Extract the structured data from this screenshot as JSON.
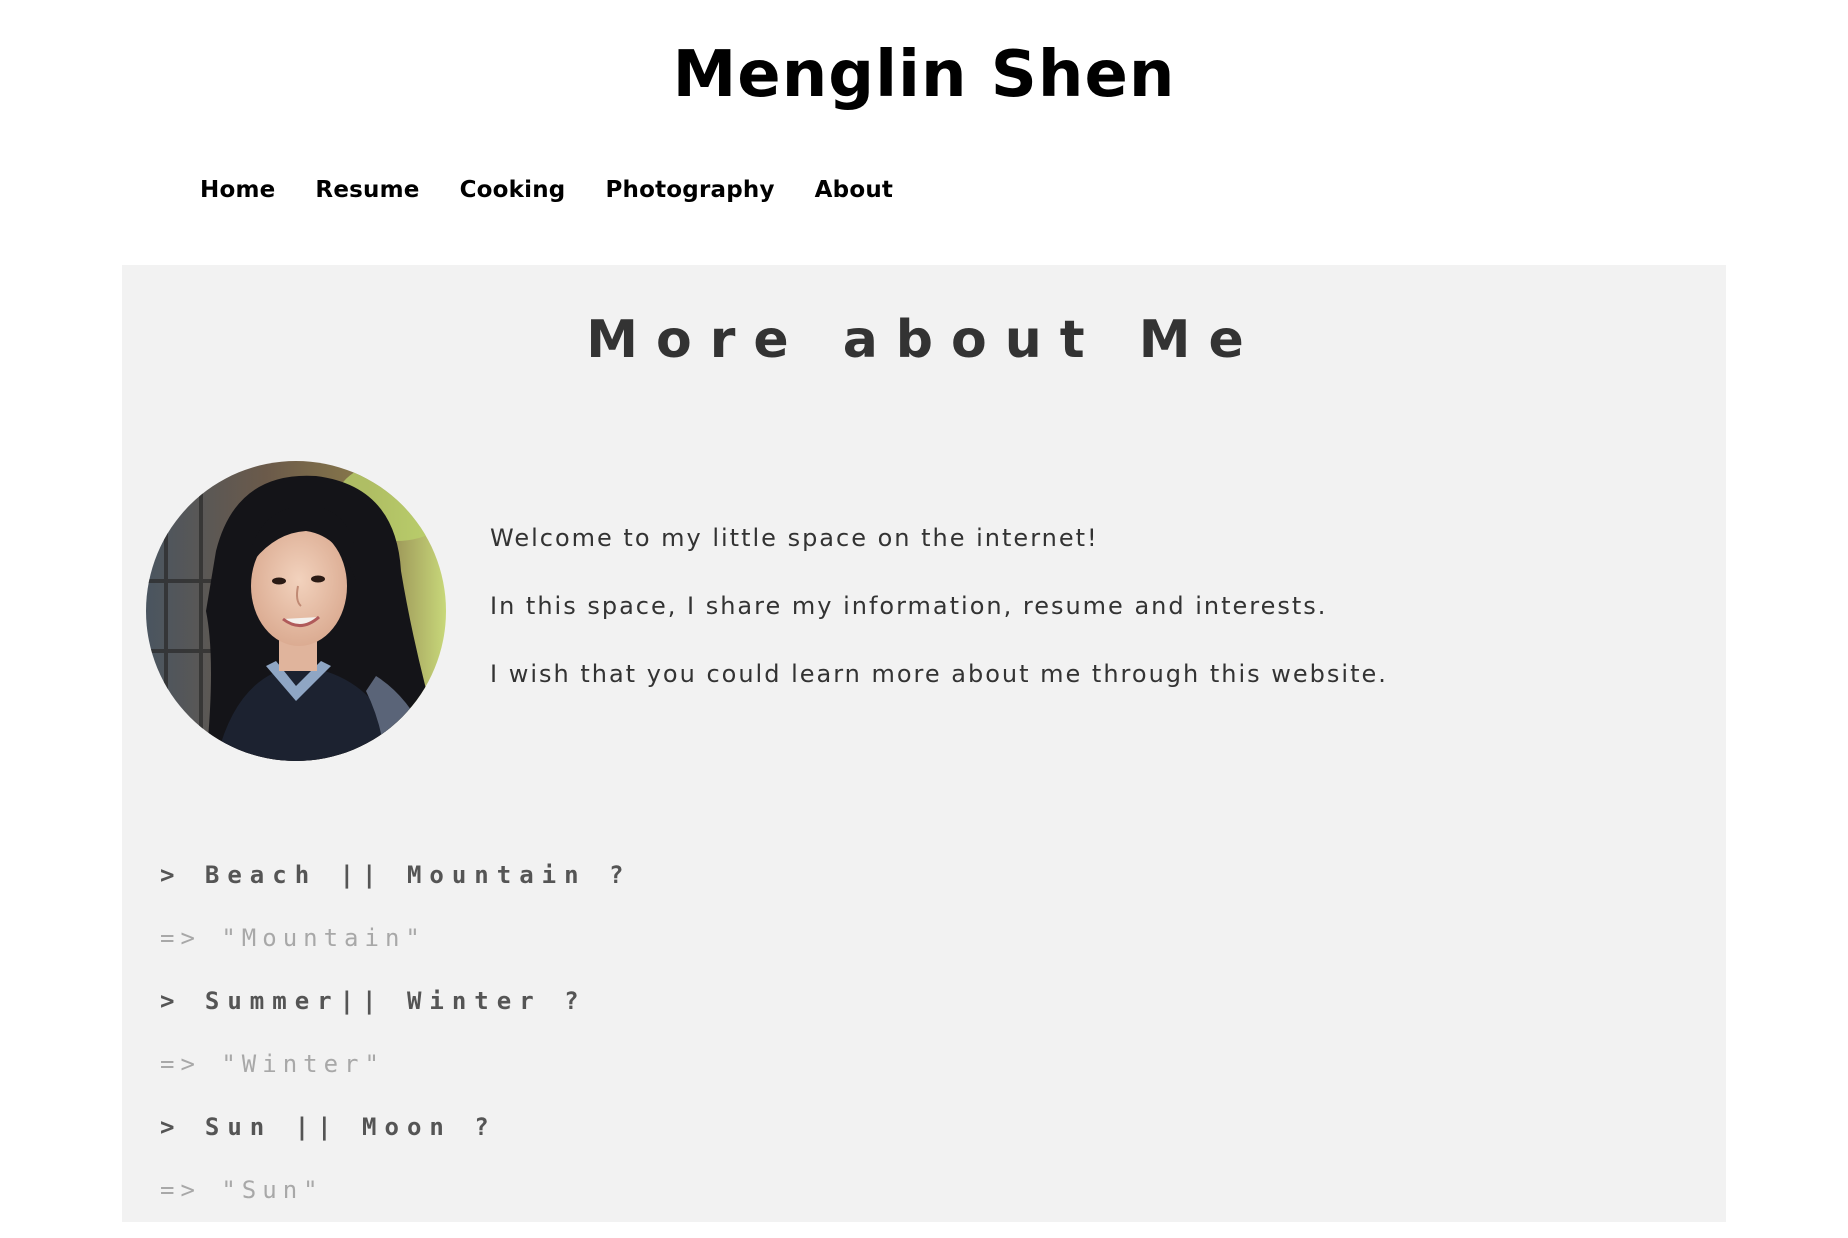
{
  "site": {
    "title": "Menglin Shen"
  },
  "nav": {
    "items": [
      {
        "label": "Home"
      },
      {
        "label": "Resume"
      },
      {
        "label": "Cooking"
      },
      {
        "label": "Photography"
      },
      {
        "label": "About"
      }
    ]
  },
  "about": {
    "heading": "More about Me",
    "intro": [
      "Welcome to my little space on the internet!",
      "In this space, I share my information, resume and interests.",
      "I wish that you could learn more about me through this website."
    ],
    "qa": [
      {
        "question": "> Beach || Mountain ?",
        "answer": "=> \"Mountain\""
      },
      {
        "question": "> Summer|| Winter ?",
        "answer": "=> \"Winter\""
      },
      {
        "question": "> Sun || Moon ?",
        "answer": "=> \"Sun\""
      }
    ]
  },
  "colors": {
    "content_bg": "#f2f2f2",
    "heading": "#333333",
    "question": "#555555",
    "answer": "#a8a8a8"
  }
}
